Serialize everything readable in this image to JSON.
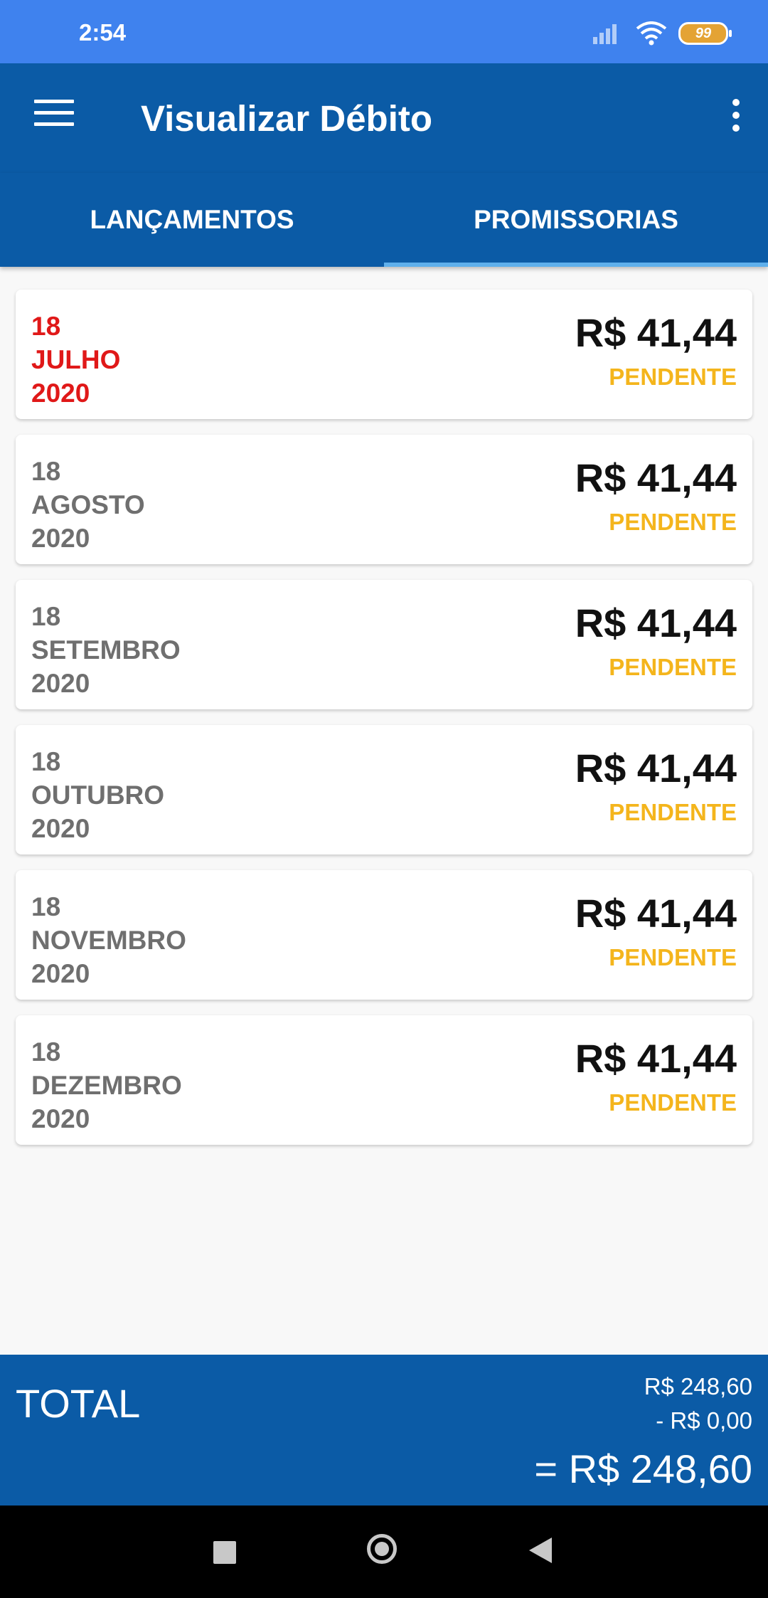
{
  "status_bar": {
    "time": "2:54",
    "battery": "99"
  },
  "app_bar": {
    "title": "Visualizar Débito"
  },
  "tabs": [
    {
      "label": "LANÇAMENTOS",
      "active": false
    },
    {
      "label": "PROMISSORIAS",
      "active": true
    }
  ],
  "items": [
    {
      "day": "18",
      "month": "JULHO",
      "year": "2020",
      "amount": "R$ 41,44",
      "status": "PENDENTE",
      "overdue": true
    },
    {
      "day": "18",
      "month": "AGOSTO",
      "year": "2020",
      "amount": "R$ 41,44",
      "status": "PENDENTE",
      "overdue": false
    },
    {
      "day": "18",
      "month": "SETEMBRO",
      "year": "2020",
      "amount": "R$ 41,44",
      "status": "PENDENTE",
      "overdue": false
    },
    {
      "day": "18",
      "month": "OUTUBRO",
      "year": "2020",
      "amount": "R$ 41,44",
      "status": "PENDENTE",
      "overdue": false
    },
    {
      "day": "18",
      "month": "NOVEMBRO",
      "year": "2020",
      "amount": "R$ 41,44",
      "status": "PENDENTE",
      "overdue": false
    },
    {
      "day": "18",
      "month": "DEZEMBRO",
      "year": "2020",
      "amount": "R$ 41,44",
      "status": "PENDENTE",
      "overdue": false
    }
  ],
  "footer": {
    "label": "TOTAL",
    "subtotal": "R$ 248,60",
    "discount": "- R$ 0,00",
    "total": "= R$ 248,60"
  },
  "colors": {
    "status_bar": "#3f82ee",
    "primary": "#0b5ba6",
    "tab_indicator": "#5fb0ec",
    "overdue": "#e01818",
    "pending": "#f4b51c"
  }
}
